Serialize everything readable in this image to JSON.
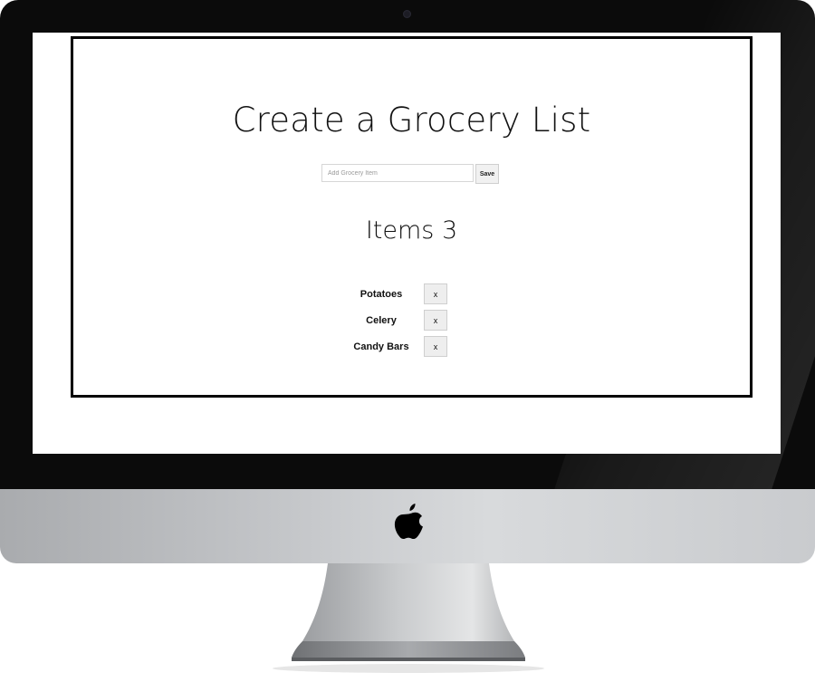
{
  "app": {
    "title": "Create a Grocery List",
    "input_placeholder": "Add Grocery Item",
    "input_value": "",
    "save_label": "Save",
    "items_heading": "Items 3",
    "items": [
      {
        "name": "Potatoes",
        "remove_label": "x"
      },
      {
        "name": "Celery",
        "remove_label": "x"
      },
      {
        "name": "Candy Bars",
        "remove_label": "x"
      }
    ]
  },
  "device": {
    "logo_icon": "apple-logo-icon",
    "bezel_color": "#0b0b0b",
    "chin_color": "#c4c6c9"
  }
}
